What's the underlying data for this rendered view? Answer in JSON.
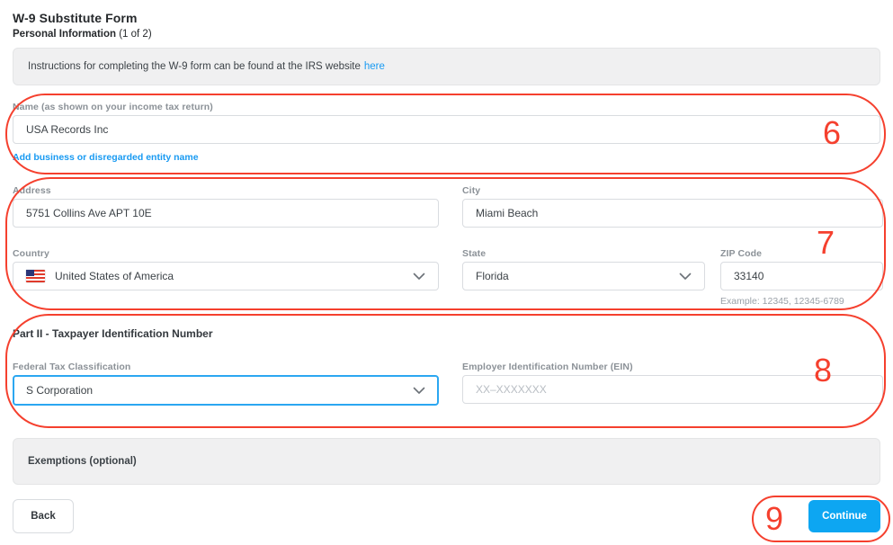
{
  "header": {
    "title": "W-9 Substitute Form",
    "step_bold": "Personal Information",
    "step_rest": " (1 of 2)"
  },
  "info_banner": {
    "text": "Instructions for completing the W-9 form can be found at the IRS website",
    "link_label": "here"
  },
  "name_section": {
    "label": "Name (as shown on your income tax return)",
    "value": "USA Records Inc",
    "add_link_label": "Add business or disregarded entity name"
  },
  "address_section": {
    "address_label": "Address",
    "address_value": "5751 Collins Ave APT 10E",
    "city_label": "City",
    "city_value": "Miami Beach",
    "country_label": "Country",
    "country_value": "United States of America",
    "state_label": "State",
    "state_value": "Florida",
    "zip_label": "ZIP Code",
    "zip_value": "33140",
    "zip_hint": "Example: 12345, 12345-6789"
  },
  "part2_section": {
    "heading": "Part II - Taxpayer Identification Number",
    "classification_label": "Federal Tax Classification",
    "classification_value": "S Corporation",
    "ein_label": "Employer Identification Number (EIN)",
    "ein_placeholder": "XX–XXXXXXX"
  },
  "exemptions": {
    "label": "Exemptions (optional)"
  },
  "footer": {
    "back_label": "Back",
    "continue_label": "Continue"
  },
  "annotations": {
    "color": "#f5402e",
    "items": [
      {
        "label": "6"
      },
      {
        "label": "7"
      },
      {
        "label": "8"
      },
      {
        "label": "9"
      }
    ]
  },
  "colors": {
    "primary_blue": "#0da6f2",
    "link_blue": "#189af2",
    "focus_border": "#2ba7f1",
    "banner_gray": "#f0f0f1",
    "label_gray": "#8b9197"
  }
}
